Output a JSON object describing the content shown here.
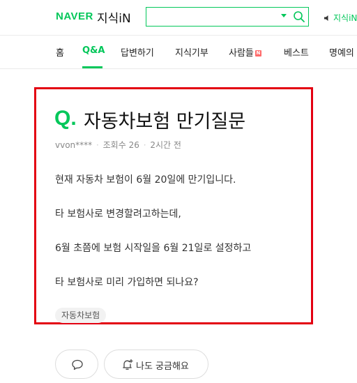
{
  "header": {
    "brand": "NAVER",
    "service": "지식iN",
    "search": {
      "value": "",
      "placeholder": ""
    },
    "right_link": "지식iN"
  },
  "nav": {
    "items": [
      {
        "label": "홈"
      },
      {
        "label": "Q&A",
        "active": true
      },
      {
        "label": "답변하기"
      },
      {
        "label": "지식기부"
      },
      {
        "label": "사람들",
        "badge": "N"
      },
      {
        "label": "베스트"
      },
      {
        "label": "명예의"
      }
    ]
  },
  "question": {
    "q_mark": "Q.",
    "title": "자동차보험 만기질문",
    "author": "vvon****",
    "views": "조회수 26",
    "time": "2시간 전",
    "body": [
      "현재 자동차 보험이 6월 20일에 만기입니다.",
      "타 보험사로 변경할려고하는데,",
      "6월 초쯤에 보험 시작일을 6월 21일로 설정하고",
      "타 보험사로 미리 가입하면 되나요?"
    ],
    "tag": "자동차보험"
  },
  "actions": {
    "curious_label": "나도 궁금해요"
  },
  "colors": {
    "brand_green": "#03c75a",
    "highlight_red": "#e30011"
  }
}
